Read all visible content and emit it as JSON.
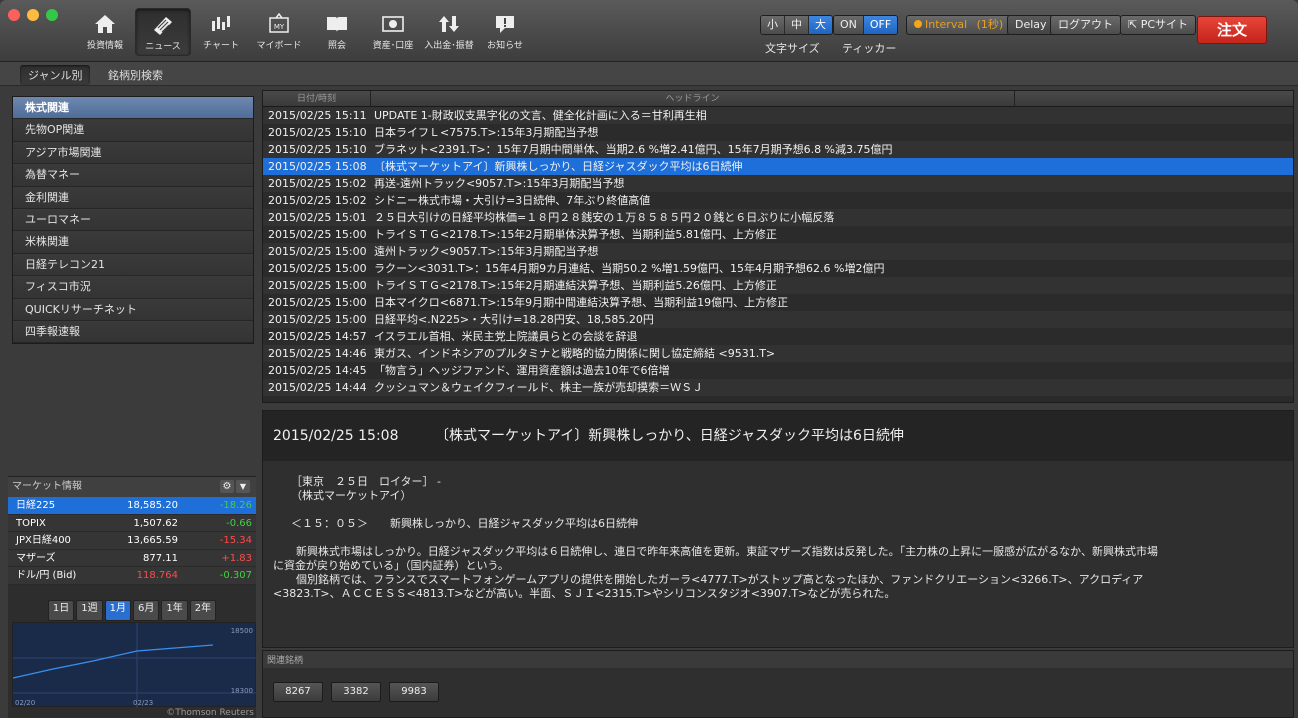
{
  "toolbar": {
    "nav": [
      {
        "label": "投資情報",
        "icon": "home-icon"
      },
      {
        "label": "ニュース",
        "icon": "news-icon"
      },
      {
        "label": "チャート",
        "icon": "chart-icon"
      },
      {
        "label": "マイボード",
        "icon": "myboard-icon",
        "glyph": "MY"
      },
      {
        "label": "照会",
        "icon": "book-icon"
      },
      {
        "label": "資産･口座",
        "icon": "asset-icon"
      },
      {
        "label": "入出金･振替",
        "icon": "transfer-icon"
      },
      {
        "label": "お知らせ",
        "icon": "notice-icon"
      }
    ],
    "font_size": {
      "options": [
        "小",
        "中",
        "大"
      ],
      "selected": "大",
      "label": "文字サイズ"
    },
    "ticker": {
      "on": "ON",
      "off": "OFF",
      "selected": "OFF",
      "label": "ティッカー"
    },
    "interval": "Interval",
    "interval_sec": "(1秒)",
    "delay": "Delay",
    "logout": "ログアウト",
    "pcsite": "PCサイト",
    "order": "注文"
  },
  "subtabs": [
    "ジャンル別",
    "銘柄別検索"
  ],
  "genres": [
    "株式関連",
    "先物OP関連",
    "アジア市場関連",
    "為替マネー",
    "金利関連",
    "ユーロマネー",
    "米株関連",
    "日経テレコン21",
    "フィスコ市況",
    "QUICKリサーチネット",
    "四季報速報"
  ],
  "market": {
    "title": "マーケット情報",
    "rows": [
      {
        "name": "日経225",
        "value": "18,585.20",
        "change": "-18.26"
      },
      {
        "name": "TOPIX",
        "value": "1,507.62",
        "change": "-0.66"
      },
      {
        "name": "JPX日経400",
        "value": "13,665.59",
        "change": "-15.34"
      },
      {
        "name": "マザーズ",
        "value": "877.11",
        "change": "+1.83"
      },
      {
        "name": "ドル/円 (Bid)",
        "value": "118.764",
        "change": "-0.307"
      }
    ],
    "periods": [
      "1日",
      "1週",
      "1月",
      "6月",
      "1年",
      "2年"
    ],
    "selected_period": "1月",
    "chart": {
      "y_top": "18500",
      "y_bottom": "18300",
      "x_left": "02/20",
      "x_mid": "02/23"
    },
    "credit": "©Thomson Reuters"
  },
  "news": {
    "headers": {
      "date": "日付/時刻",
      "headline": "ヘッドライン"
    },
    "rows": [
      {
        "date": "2015/02/25 15:11",
        "headline": "UPDATE 1-財政収支黒字化の文言、健全化計画に入る＝甘利再生相"
      },
      {
        "date": "2015/02/25 15:10",
        "headline": "日本ライフＬ<7575.T>:15年3月期配当予想"
      },
      {
        "date": "2015/02/25 15:10",
        "headline": "ブラネット<2391.T>：15年7月期中間単体、当期2.6 %増2.41億円、15年7月期予想6.8 %減3.75億円"
      },
      {
        "date": "2015/02/25 15:08",
        "headline": "〔株式マーケットアイ〕新興株しっかり、日経ジャスダック平均は6日続伸"
      },
      {
        "date": "2015/02/25 15:02",
        "headline": "再送-遠州トラック<9057.T>:15年3月期配当予想"
      },
      {
        "date": "2015/02/25 15:02",
        "headline": "シドニー株式市場・大引け=3日続伸、7年ぶり終値高値"
      },
      {
        "date": "2015/02/25 15:01",
        "headline": "２５日大引けの日経平均株価=１８円２８銭安の１万８５８５円２０銭と６日ぶりに小幅反落"
      },
      {
        "date": "2015/02/25 15:00",
        "headline": "トライＳＴＧ<2178.T>:15年2月期単体決算予想、当期利益5.81億円、上方修正"
      },
      {
        "date": "2015/02/25 15:00",
        "headline": "遠州トラック<9057.T>:15年3月期配当予想"
      },
      {
        "date": "2015/02/25 15:00",
        "headline": "ラクーン<3031.T>：15年4月期9カ月連結、当期50.2 %増1.59億円、15年4月期予想62.6 %増2億円"
      },
      {
        "date": "2015/02/25 15:00",
        "headline": "トライＳＴＧ<2178.T>:15年2月期連結決算予想、当期利益5.26億円、上方修正"
      },
      {
        "date": "2015/02/25 15:00",
        "headline": "日本マイクロ<6871.T>:15年9月期中間連結決算予想、当期利益19億円、上方修正"
      },
      {
        "date": "2015/02/25 15:00",
        "headline": "日経平均<.N225>・大引け=18.28円安、18,585.20円"
      },
      {
        "date": "2015/02/25 14:57",
        "headline": "イスラエル首相、米民主党上院議員らとの会談を辞退"
      },
      {
        "date": "2015/02/25 14:46",
        "headline": "東ガス、インドネシアのプルタミナと戦略的協力関係に関し協定締結 <9531.T>"
      },
      {
        "date": "2015/02/25 14:45",
        "headline": "「物言う」ヘッジファンド、運用資産額は過去10年で6倍増"
      },
      {
        "date": "2015/02/25 14:44",
        "headline": "クッシュマン＆ウェイクフィールド、株主一族が売却摸索＝ＷＳＪ"
      }
    ],
    "selected_index": 3
  },
  "article": {
    "date": "2015/02/25 15:08",
    "title": "〔株式マーケットアイ〕新興株しっかり、日経ジャスダック平均は6日続伸",
    "line1": "［東京　２５日　ロイター］ -",
    "line2": "（株式マーケットアイ）",
    "line3": "＜１５：０５＞　　新興株しっかり、日経ジャスダック平均は6日続伸",
    "line4": "　新興株式市場はしっかり。日経ジャスダック平均は６日続伸し、連日で昨年来高値を更新。東証マザーズ指数は反発した。「主力株の上昇に一服感が広がるなか、新興株式市場",
    "line5": "に資金が戻り始めている」（国内証券）という。",
    "line6": "　個別銘柄では、フランスでスマートフォンゲームアプリの提供を開始したガーラ<4777.T>がストップ高となったほか、ファンドクリエーション<3266.T>、アクロディア",
    "line7": "<3823.T>、ＡＣＣＥＳＳ<4813.T>などが高い。半面、ＳＪＩ<2315.T>やシリコンスタジオ<3907.T>などが売られた。"
  },
  "related": {
    "title": "関連銘柄",
    "codes": [
      "8267",
      "3382",
      "9983"
    ]
  }
}
